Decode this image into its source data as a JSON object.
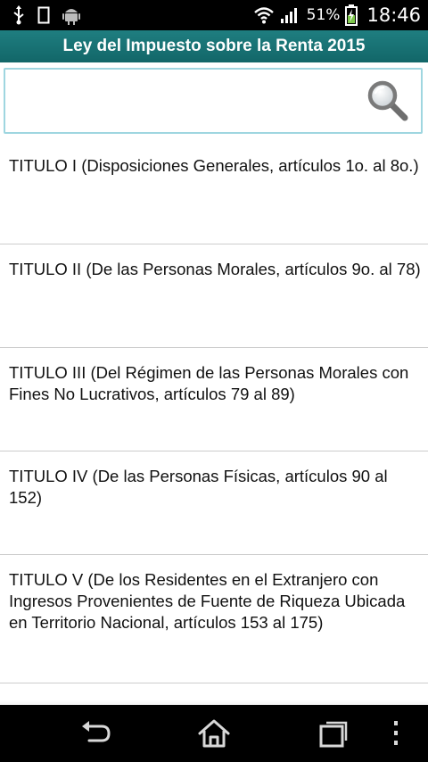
{
  "status_bar": {
    "battery_percent": "51%",
    "time": "18:46",
    "icons": [
      "usb-icon",
      "notification-icon",
      "android-icon",
      "wifi-icon",
      "signal-icon",
      "battery-charging-icon"
    ]
  },
  "header": {
    "title": "Ley del Impuesto sobre la Renta 2015"
  },
  "search": {
    "value": "",
    "placeholder": "",
    "icon": "search-icon"
  },
  "list": {
    "items": [
      {
        "label": "TITULO I (Disposiciones Generales, artículos 1o. al 8o.)"
      },
      {
        "label": "TITULO II (De las Personas Morales, artículos 9o. al 78)"
      },
      {
        "label": "TITULO III (Del Régimen de las Personas Morales con Fines No Lucrativos, artículos 79 al 89)"
      },
      {
        "label": "TITULO IV (De las Personas Físicas, artículos 90 al 152)"
      },
      {
        "label": "TITULO V (De los Residentes en el Extranjero con Ingresos Provenientes de Fuente de Riqueza Ubicada en Territorio Nacional, artículos 153 al 175)"
      }
    ]
  },
  "nav_bar": {
    "icons": [
      "back-icon",
      "home-icon",
      "recent-apps-icon",
      "menu-icon"
    ]
  },
  "colors": {
    "title_bar": "#1a7476",
    "search_border": "#9fd6e0",
    "divider": "#cccccc"
  }
}
